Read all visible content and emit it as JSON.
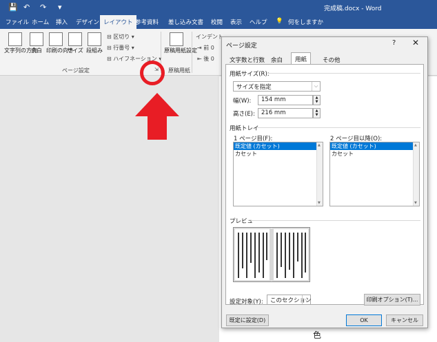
{
  "titlebar": {
    "document_title": "完成稿.docx - Word"
  },
  "tabs": [
    "ファイル",
    "ホーム",
    "挿入",
    "デザイン",
    "レイアウト",
    "参考資料",
    "差し込み文書",
    "校閲",
    "表示",
    "ヘルプ"
  ],
  "tell_me": "何をしますか",
  "ribbon": {
    "text_direction": "文字列の方向",
    "margins": "余白",
    "orientation": "印刷の向き",
    "size": "サイズ",
    "columns": "段組み",
    "breaks": "区切り",
    "line_numbers": "行番号",
    "hyphenation": "ハイフネーション",
    "page_setup_group": "ページ設定",
    "manuscript": "原稿用紙設定",
    "manuscript_group": "原稿用紙",
    "indent": "インデント",
    "indent_before": "前",
    "indent_after": "後",
    "indent_value": "0"
  },
  "dialog": {
    "title": "ページ設定",
    "help": "?",
    "tabs": [
      "文字数と行数",
      "余白",
      "用紙",
      "その他"
    ],
    "active_tab": "用紙",
    "paper_size_label": "用紙サイズ(R):",
    "paper_size_value": "サイズを指定",
    "width_label": "幅(W):",
    "width_value": "154 mm",
    "height_label": "高さ(E):",
    "height_value": "216 mm",
    "paper_tray_label": "用紙トレイ",
    "first_page_label": "1 ページ目(F):",
    "other_pages_label": "2 ページ目以降(O):",
    "tray_items": [
      "既定値 (カセット)",
      "カセット"
    ],
    "preview_label": "プレビュー",
    "apply_to_label": "設定対象(Y):",
    "apply_to_value": "このセクション",
    "print_options": "印刷オプション(T)...",
    "set_default": "既定に設定(D)",
    "ok": "OK",
    "cancel": "キャンセル"
  },
  "document_text": "色",
  "annotation_colors": {
    "highlight": "#e81d25",
    "accent": "#2b579a"
  }
}
